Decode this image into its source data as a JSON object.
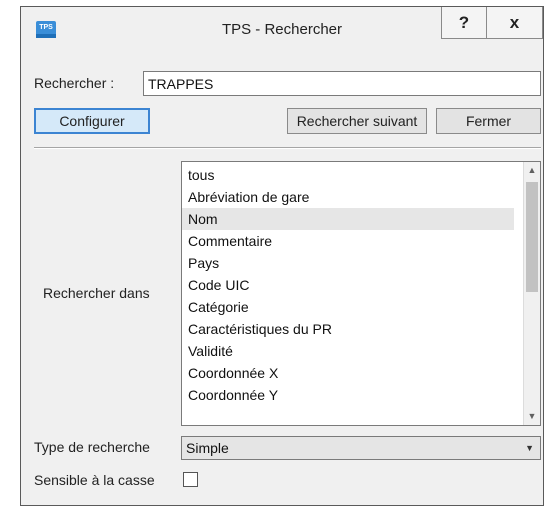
{
  "window": {
    "app_icon_text": "TPS",
    "title": "TPS  - Rechercher",
    "help_label": "?",
    "close_label": "x"
  },
  "search": {
    "label": "Rechercher :",
    "value": "TRAPPES"
  },
  "buttons": {
    "configure": "Configurer",
    "find_next": "Rechercher suivant",
    "close": "Fermer"
  },
  "search_in": {
    "label": "Rechercher dans",
    "items": [
      "tous",
      "Abréviation de gare",
      "Nom",
      "Commentaire",
      "Pays",
      "Code UIC",
      "Catégorie",
      "Caractéristiques du PR",
      "Validité",
      "Coordonnée X",
      "Coordonnée Y"
    ],
    "selected": "Nom"
  },
  "search_type": {
    "label": "Type de recherche",
    "value": "Simple"
  },
  "case_sensitive": {
    "label": "Sensible à la casse",
    "checked": false
  },
  "icons": {
    "scroll_up": "scroll-up-icon",
    "scroll_down": "scroll-down-icon",
    "dropdown": "chevron-down-icon"
  }
}
